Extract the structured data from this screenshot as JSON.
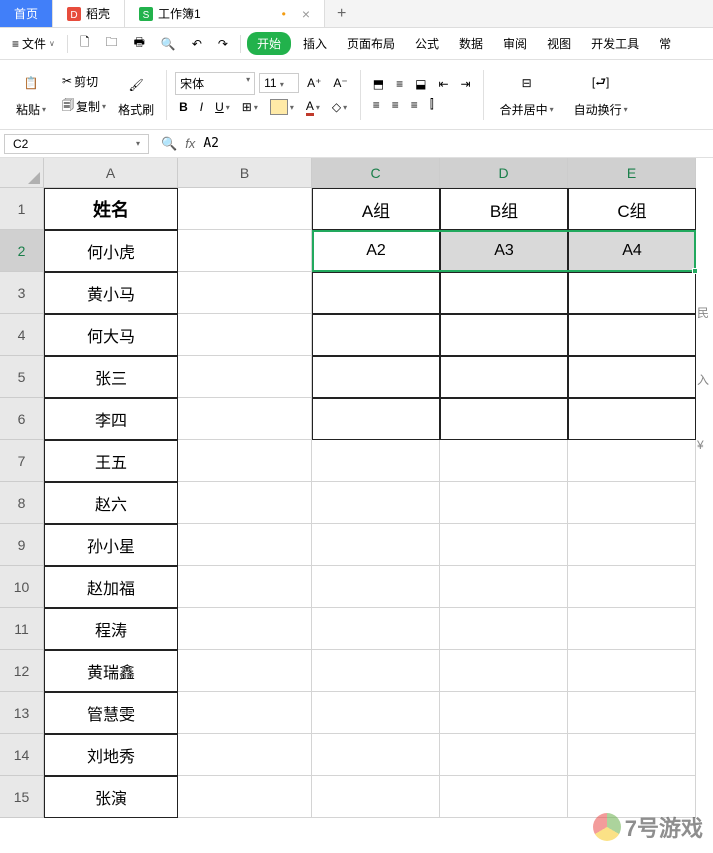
{
  "tabs": {
    "home": "首页",
    "daoke": "稻壳",
    "workbook": "工作簿1",
    "dirty_marker": "•"
  },
  "menu": {
    "file": "文件",
    "start": "开始",
    "insert": "插入",
    "page_layout": "页面布局",
    "formula": "公式",
    "data": "数据",
    "review": "审阅",
    "view": "视图",
    "dev_tools": "开发工具",
    "more": "常"
  },
  "ribbon": {
    "paste": "粘贴",
    "cut": "剪切",
    "copy": "复制",
    "format_painter": "格式刷",
    "font_name": "宋体",
    "font_size": "11",
    "merge_center": "合并居中",
    "auto_wrap": "自动换行"
  },
  "name_box": "C2",
  "formula": "A2",
  "columns": [
    "A",
    "B",
    "C",
    "D",
    "E"
  ],
  "rows": [
    "1",
    "2",
    "3",
    "4",
    "5",
    "6",
    "7",
    "8",
    "9",
    "10",
    "11",
    "12",
    "13",
    "14",
    "15"
  ],
  "cells": {
    "A1": "姓名",
    "C1": "A组",
    "D1": "B组",
    "E1": "C组",
    "C2": "A2",
    "D2": "A3",
    "E2": "A4",
    "A2": "何小虎",
    "A3": "黄小马",
    "A4": "何大马",
    "A5": "张三",
    "A6": "李四",
    "A7": "王五",
    "A8": "赵六",
    "A9": "孙小星",
    "A10": "赵加福",
    "A11": "程涛",
    "A12": "黄瑞鑫",
    "A13": "管慧雯",
    "A14": "刘地秀",
    "A15": "张演"
  },
  "side": {
    "a": "民",
    "b": "入",
    "c": "¥"
  },
  "watermark": "7号游戏"
}
